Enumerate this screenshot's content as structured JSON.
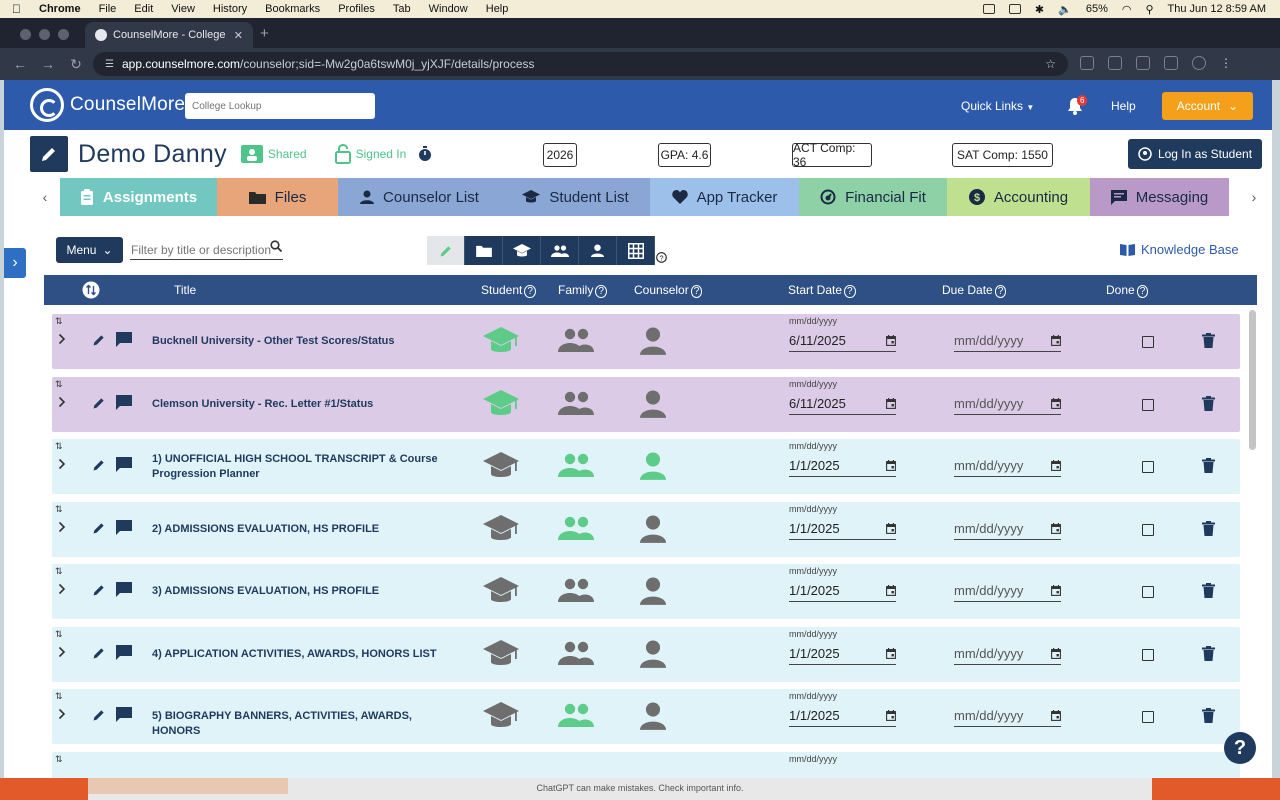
{
  "mac_menubar": {
    "app": "Chrome",
    "items": [
      "File",
      "Edit",
      "View",
      "History",
      "Bookmarks",
      "Profiles",
      "Tab",
      "Window",
      "Help"
    ],
    "battery": "65%",
    "datetime": "Thu Jun 12  8:59 AM"
  },
  "browser": {
    "tab_title": "CounselMore - College Planni",
    "url_host": "app.counselmore.com",
    "url_path": "/counselor;sid=-Mw2g0a6tswM0j_yjXJF/details/process"
  },
  "header": {
    "brand": "CounselMore",
    "college_lookup_placeholder": "College Lookup",
    "quick_links": "Quick Links",
    "notification_count": "6",
    "help": "Help",
    "account": "Account"
  },
  "student": {
    "name": "Demo Danny",
    "shared": "Shared",
    "signed_in": "Signed In",
    "year": "2026",
    "gpa": "GPA: 4.6",
    "act": "ACT Comp: 36",
    "sat": "SAT  Comp: 1550",
    "login_as_student": "Log In as Student"
  },
  "tabs": [
    {
      "label": "Assignments",
      "color": "#72c8c0"
    },
    {
      "label": "Files",
      "color": "#e8a57a"
    },
    {
      "label": "Counselor List",
      "color": "#8aa6d4"
    },
    {
      "label": "Student List",
      "color": "#8aa6d4"
    },
    {
      "label": "App Tracker",
      "color": "#9cc0ea"
    },
    {
      "label": "Financial Fit",
      "color": "#8ed1a6"
    },
    {
      "label": "Accounting",
      "color": "#bfe08e"
    },
    {
      "label": "Messaging",
      "color": "#b899c8"
    }
  ],
  "toolbar": {
    "menu": "Menu",
    "filter_placeholder": "Filter by title or description",
    "knowledge_base": "Knowledge Base"
  },
  "table": {
    "columns": {
      "title": "Title",
      "student": "Student",
      "family": "Family",
      "counselor": "Counselor",
      "start_date": "Start Date",
      "due_date": "Due Date",
      "done": "Done"
    },
    "date_hint": "mm/dd/yyyy",
    "rows": [
      {
        "title": "Bucknell University - Other Test Scores/Status",
        "start": "6/11/2025",
        "due": "mm/dd/yyyy",
        "student_active": true,
        "family_active": false,
        "counselor_active": false,
        "bg": "#dccbe6"
      },
      {
        "title": "Clemson University - Rec. Letter #1/Status",
        "start": "6/11/2025",
        "due": "mm/dd/yyyy",
        "student_active": true,
        "family_active": false,
        "counselor_active": false,
        "bg": "#dccbe6"
      },
      {
        "title": "1) UNOFFICIAL HIGH SCHOOL TRANSCRIPT & Course Progression Planner",
        "start": "1/1/2025",
        "due": "mm/dd/yyyy",
        "student_active": false,
        "family_active": true,
        "counselor_active": true,
        "bg": "#dff3f9"
      },
      {
        "title": "2) ADMISSIONS EVALUATION, HS PROFILE",
        "start": "1/1/2025",
        "due": "mm/dd/yyyy",
        "student_active": false,
        "family_active": true,
        "counselor_active": false,
        "bg": "#dff3f9"
      },
      {
        "title": "3) ADMISSIONS EVALUATION, HS PROFILE",
        "start": "1/1/2025",
        "due": "mm/dd/yyyy",
        "student_active": false,
        "family_active": false,
        "counselor_active": false,
        "bg": "#dff3f9"
      },
      {
        "title": "4) APPLICATION ACTIVITIES, AWARDS, HONORS LIST",
        "start": "1/1/2025",
        "due": "mm/dd/yyyy",
        "student_active": false,
        "family_active": false,
        "counselor_active": false,
        "bg": "#dff3f9"
      },
      {
        "title": "5) BIOGRAPHY BANNERS, ACTIVITIES, AWARDS, HONORS",
        "start": "1/1/2025",
        "due": "mm/dd/yyyy",
        "student_active": false,
        "family_active": true,
        "counselor_active": false,
        "bg": "#dff3f9"
      },
      {
        "title": "",
        "start": "",
        "due": "",
        "student_active": false,
        "family_active": false,
        "counselor_active": false,
        "bg": "#dff3f9"
      }
    ]
  },
  "footer_note": "ChatGPT can make mistakes. Check important info.",
  "colors": {
    "active_green": "#5ccc88",
    "inactive_gray": "#6e6e6e",
    "navy": "#1f3a5c",
    "brand_blue": "#2e5aac"
  }
}
